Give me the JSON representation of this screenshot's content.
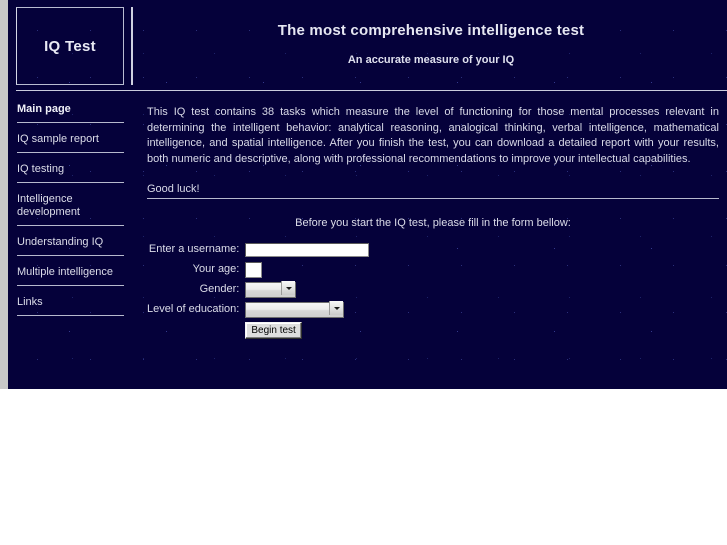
{
  "header": {
    "logo": "IQ Test",
    "title": "The most comprehensive intelligence test",
    "subtitle": "An accurate measure of your IQ"
  },
  "sidebar": {
    "items": [
      {
        "label": "Main page",
        "active": true
      },
      {
        "label": "IQ sample report",
        "active": false
      },
      {
        "label": "IQ testing",
        "active": false
      },
      {
        "label": "Intelligence development",
        "active": false
      },
      {
        "label": "Understanding IQ",
        "active": false
      },
      {
        "label": "Multiple intelligence",
        "active": false
      },
      {
        "label": "Links",
        "active": false
      }
    ]
  },
  "content": {
    "intro": "This IQ test contains 38 tasks which measure the level of functioning for those mental processes relevant in determining the intelligent behavior: analytical reasoning, analogical thinking, verbal intelligence, mathematical intelligence, and spatial intelligence. After you finish the test, you can download a detailed report with your results, both numeric and descriptive, along with professional recommendations to improve your intellectual capabilities.",
    "goodluck": "Good luck!"
  },
  "form": {
    "prompt": "Before you start the IQ test, please fill in the form bellow:",
    "username_label": "Enter a username:",
    "username_value": "",
    "age_label": "Your age:",
    "age_value": "",
    "gender_label": "Gender:",
    "gender_value": "",
    "education_label": "Level of education:",
    "education_value": "",
    "submit_label": "Begin test"
  },
  "colors": {
    "background": "#05013a",
    "text": "#dcdde9",
    "rule": "#b7b9cd",
    "gutter": "#c8c8c8"
  }
}
